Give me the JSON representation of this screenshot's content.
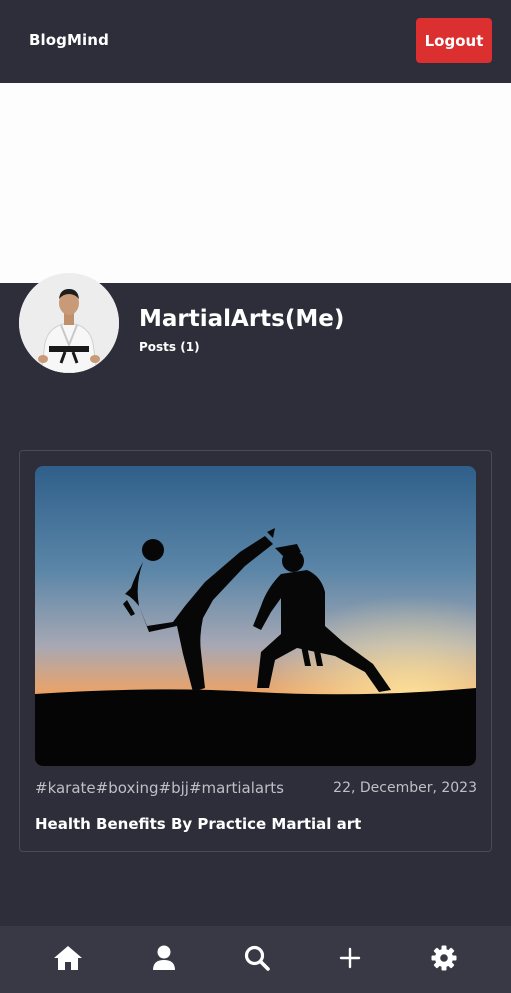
{
  "header": {
    "brand": "BlogMind",
    "logout_label": "Logout"
  },
  "profile": {
    "username": "MartialArts(Me)",
    "posts_label": "Posts (1)",
    "avatar_icon": "karate-person-avatar"
  },
  "posts": [
    {
      "tags": "#karate#boxing#bjj#martialarts",
      "date": "22, December, 2023",
      "title": "Health Benefits By Practice Martial art",
      "image": "martial-arts-sunset-silhouette"
    }
  ],
  "bottom_nav": {
    "items": [
      "home-icon",
      "profile-icon",
      "search-icon",
      "add-icon",
      "settings-icon"
    ]
  },
  "colors": {
    "background": "#2e2e3a",
    "nav_background": "#393946",
    "logout": "#dc2f2f",
    "muted_text": "#bfbfc6"
  }
}
